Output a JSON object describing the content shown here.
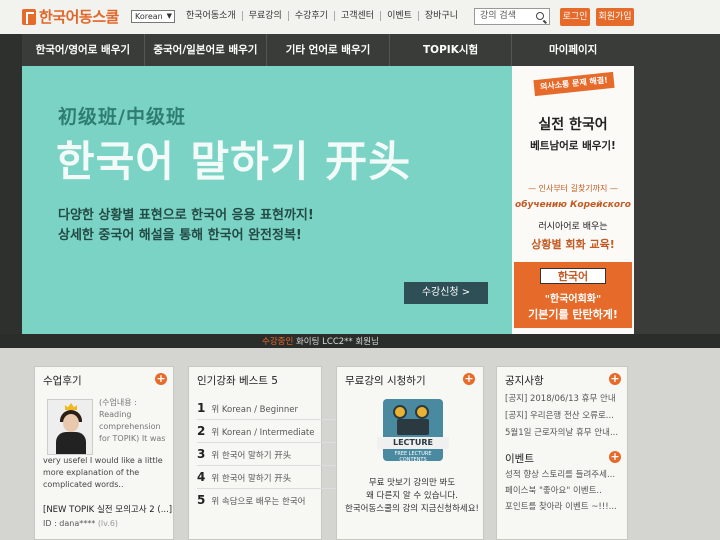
{
  "header": {
    "logo_text": "한국어동스쿨",
    "language": "Korean",
    "nav": [
      "한국어동소개",
      "무료강의",
      "수강후기",
      "고객센터",
      "이벤트",
      "장바구니"
    ],
    "search_placeholder": "강의 검색",
    "login_label": "로그인",
    "join_label": "회원가입"
  },
  "main_nav": [
    "한국어/영어로 배우기",
    "중국어/일본어로 배우기",
    "기타 언어로 배우기",
    "TOPIK시험",
    "마이페이지"
  ],
  "banner": {
    "subtitle": "初级班/中级班",
    "title": "한국어 말하기 开头",
    "line1": "다양한 상황별 표현으로 한국어 응용 표현까지!",
    "line2": "상세한 중국어 해설을 통해 한국어 완전정복!",
    "cta": "수강신청 >"
  },
  "promo": {
    "tag": "의사소통 문제 해결!",
    "heading1": "실전 한국어",
    "heading2": "베트남어로 배우기!",
    "separator": "— 인사부터 길찾기까지 —",
    "russian": "обучению Корейского",
    "learn": "러시아어로 배우는",
    "edu": "상황별 회화 교육!",
    "box_k": "한국어",
    "box_line1": "\"한국어회화\"",
    "box_line2": "기본기를 탄탄하게!"
  },
  "strip": {
    "highlight": "수강중인",
    "user": "화이팅 LCC2** 회원님"
  },
  "reviews": {
    "title": "수업후기",
    "side_lines": [
      "(수업내용 :",
      "Reading",
      "comprehension",
      "for TOPIK) It was"
    ],
    "body_lines": [
      "very usefel I would like a little",
      "more explanation of the",
      "complicated words.."
    ],
    "item_title": "[NEW TOPIK 실전 모의고사 2 (...]",
    "author": "ID : dana****",
    "level": "(lv.6)"
  },
  "best": {
    "title": "인기강좌 베스트 5",
    "items": [
      {
        "rank": "1",
        "unit": "위",
        "name": "Korean / Beginner"
      },
      {
        "rank": "2",
        "unit": "위",
        "name": "Korean / Intermediate"
      },
      {
        "rank": "3",
        "unit": "위",
        "name": "한국어 말하기 开头"
      },
      {
        "rank": "4",
        "unit": "위",
        "name": "한국어 말하기 开头"
      },
      {
        "rank": "5",
        "unit": "위",
        "name": "속담으로 배우는 한국어"
      }
    ]
  },
  "free_lecture": {
    "title": "무료강의 시청하기",
    "badge": "LECTURE",
    "badge_sub": "FREE LECTURE CONTENTS",
    "lines": [
      "무료 맛보기 강의만 봐도",
      "왜 다른지 알 수 있습니다.",
      "한국어동스쿨의 강의 지금신청하세요!"
    ]
  },
  "notices": {
    "title": "공지사항",
    "items": [
      "[공지] 2018/06/13 휴무 안내",
      "[공지] 우리은행 전산 오류로...",
      "5월1일 근로자의날 휴무 안내..."
    ],
    "events_title": "이벤트",
    "events": [
      "성적 향상 스토리를 들려주세...",
      "페이스북 \"좋아요\" 이벤트..",
      "포인트를 찾아라 이벤트 ~!!!..."
    ]
  },
  "colors": {
    "accent": "#e66a2a",
    "nav_bg": "#3a3c3a",
    "banner_bg": "#7bd3c5"
  }
}
